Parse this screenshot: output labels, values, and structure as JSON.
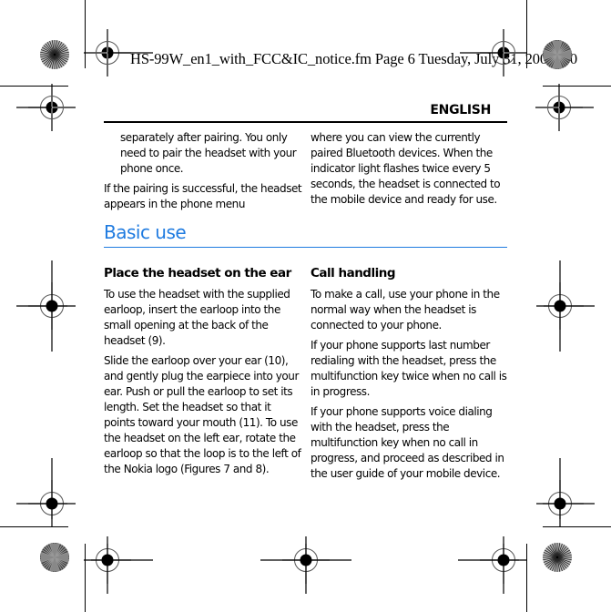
{
  "slug_line": "HS-99W_en1_with_FCC&IC_notice.fm  Page 6  Tuesday, July 31, 2007  3:0",
  "running_head": "ENGLISH",
  "intro": {
    "left_col": [
      "separately after pairing. You only need to pair the headset with your phone once.",
      "If the pairing is successful, the headset appears in the phone menu"
    ],
    "right_col": [
      "where you can view the currently paired Bluetooth devices. When the indicator light flashes twice every 5 seconds, the headset is connected to the mobile device and ready for use."
    ]
  },
  "section": {
    "title": "Basic use",
    "accent_color": "#1f7be0",
    "left": {
      "heading": "Place the headset on the ear",
      "paragraphs": [
        "To use the headset with the supplied earloop, insert the earloop into the small opening at the back of the headset (9).",
        "Slide the earloop over your ear (10), and gently plug the earpiece into your ear. Push or pull the earloop to set its length. Set the headset so that it points toward your mouth (11). To use the headset on the left ear, rotate the earloop so that the loop is to the left of the Nokia logo (Figures 7 and 8)."
      ]
    },
    "right": {
      "heading": "Call handling",
      "paragraphs": [
        "To make a call, use your phone in the normal way when the headset is connected to your phone.",
        "If your phone supports last number redialing with the headset, press the multifunction key twice when no call is in progress.",
        "If your phone supports voice dialing with the headset, press the multifunction key when no call in progress, and proceed as described in the user guide of your mobile device."
      ]
    }
  },
  "print_marks": {
    "registration_marks": [
      "top-left",
      "top-right",
      "upper-left",
      "upper-right",
      "middle-left",
      "middle-right",
      "lower-left",
      "lower-right",
      "bottom-left",
      "bottom-center",
      "bottom-right"
    ],
    "color_bars": [
      "top-left-grey",
      "top-right-dark",
      "bottom-left-dark",
      "bottom-right-grey"
    ]
  }
}
